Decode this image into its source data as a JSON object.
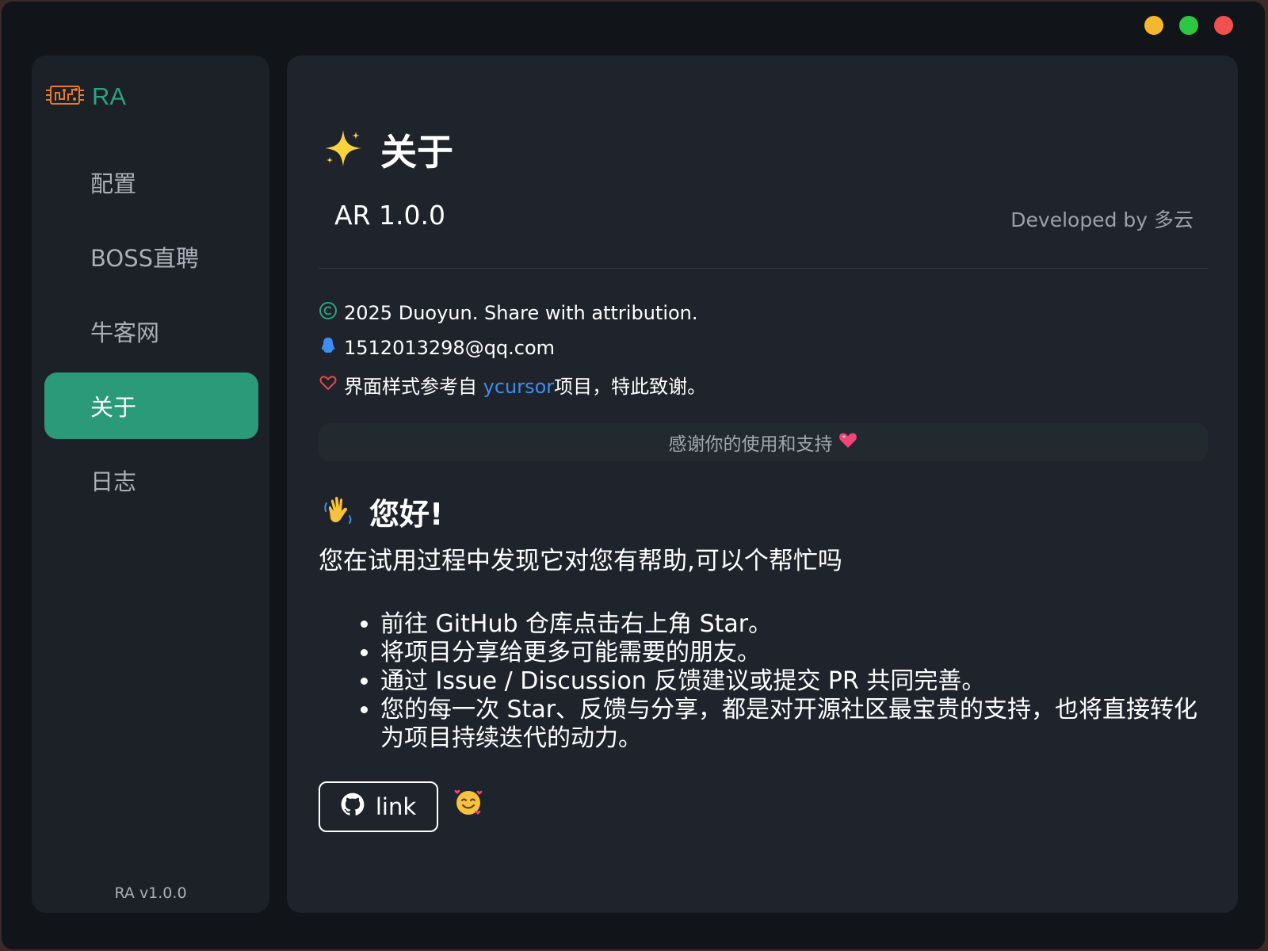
{
  "window": {
    "controls": [
      "minimize",
      "maximize",
      "close"
    ],
    "colors": {
      "minimize": "#f6b62d",
      "maximize": "#2ec743",
      "close": "#f0504e"
    }
  },
  "sidebar": {
    "brand": {
      "label": "RA",
      "icon": "circuit-chip-icon",
      "color": "#2da37e"
    },
    "items": [
      {
        "label": "配置",
        "active": false
      },
      {
        "label": "BOSS直聘",
        "active": false
      },
      {
        "label": "牛客网",
        "active": false
      },
      {
        "label": "关于",
        "active": true
      },
      {
        "label": "日志",
        "active": false
      }
    ],
    "footer_version": "RA v1.0.0",
    "accent": "#2a9a78"
  },
  "main": {
    "title": "关于",
    "title_icon": "sparkle-icon",
    "app_version": "AR 1.0.0",
    "developed_by": "Developed by 多云",
    "copyright": "2025 Duoyun. Share with attribution.",
    "email": "1512013298@qq.com",
    "credit": {
      "prefix": "界面样式参考自 ",
      "link_text": "ycursor",
      "suffix": "项目，特此致谢。"
    },
    "thanks_bar": "感谢你的使用和支持",
    "greeting": "您好!",
    "intro": "您在试用过程中发现它对您有帮助,可以个帮忙吗",
    "bullets": [
      "前往 GitHub 仓库点击右上角 Star。",
      "将项目分享给更多可能需要的朋友。",
      "通过 Issue / Discussion 反馈建议或提交 PR 共同完善。",
      "您的每一次 Star、反馈与分享，都是对开源社区最宝贵的支持，也将直接转化为项目持续迭代的动力。"
    ],
    "link_button": "link"
  }
}
